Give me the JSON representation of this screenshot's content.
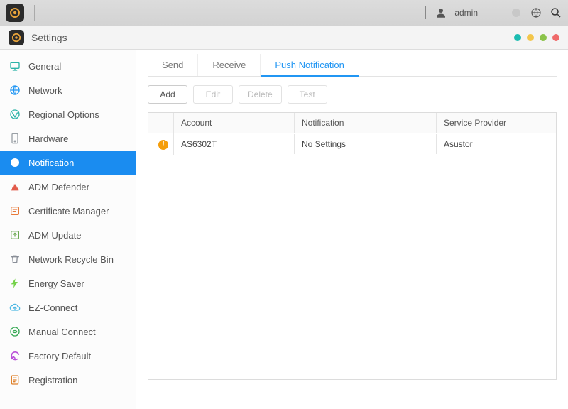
{
  "topbar": {
    "username": "admin"
  },
  "window": {
    "title": "Settings"
  },
  "sidebar": {
    "items": [
      {
        "label": "General",
        "icon": "general",
        "color": "#2bb3a7"
      },
      {
        "label": "Network",
        "icon": "globe",
        "color": "#2196f3"
      },
      {
        "label": "Regional Options",
        "icon": "regional",
        "color": "#2bb3a7"
      },
      {
        "label": "Hardware",
        "icon": "hardware",
        "color": "#9aa0a6"
      },
      {
        "label": "Notification",
        "icon": "bell",
        "color": "#ff9800",
        "active": true
      },
      {
        "label": "ADM Defender",
        "icon": "shield",
        "color": "#e25b4b"
      },
      {
        "label": "Certificate Manager",
        "icon": "cert",
        "color": "#e87a3a"
      },
      {
        "label": "ADM Update",
        "icon": "update",
        "color": "#6aa84f"
      },
      {
        "label": "Network Recycle Bin",
        "icon": "trash",
        "color": "#8a8f98"
      },
      {
        "label": "Energy Saver",
        "icon": "energy",
        "color": "#75d24a"
      },
      {
        "label": "EZ-Connect",
        "icon": "cloud",
        "color": "#4fb8e3"
      },
      {
        "label": "Manual Connect",
        "icon": "manual",
        "color": "#35a853"
      },
      {
        "label": "Factory Default",
        "icon": "reset",
        "color": "#b94fd8"
      },
      {
        "label": "Registration",
        "icon": "reg",
        "color": "#e0832e"
      }
    ]
  },
  "tabs": {
    "items": [
      {
        "label": "Send"
      },
      {
        "label": "Receive"
      },
      {
        "label": "Push Notification",
        "active": true
      }
    ]
  },
  "toolbar": {
    "add_label": "Add",
    "edit_label": "Edit",
    "delete_label": "Delete",
    "test_label": "Test"
  },
  "table": {
    "headers": {
      "account": "Account",
      "notification": "Notification",
      "provider": "Service Provider"
    },
    "rows": [
      {
        "account": "AS6302T",
        "notification": "No Settings",
        "provider": "Asustor",
        "warn": true
      }
    ]
  }
}
